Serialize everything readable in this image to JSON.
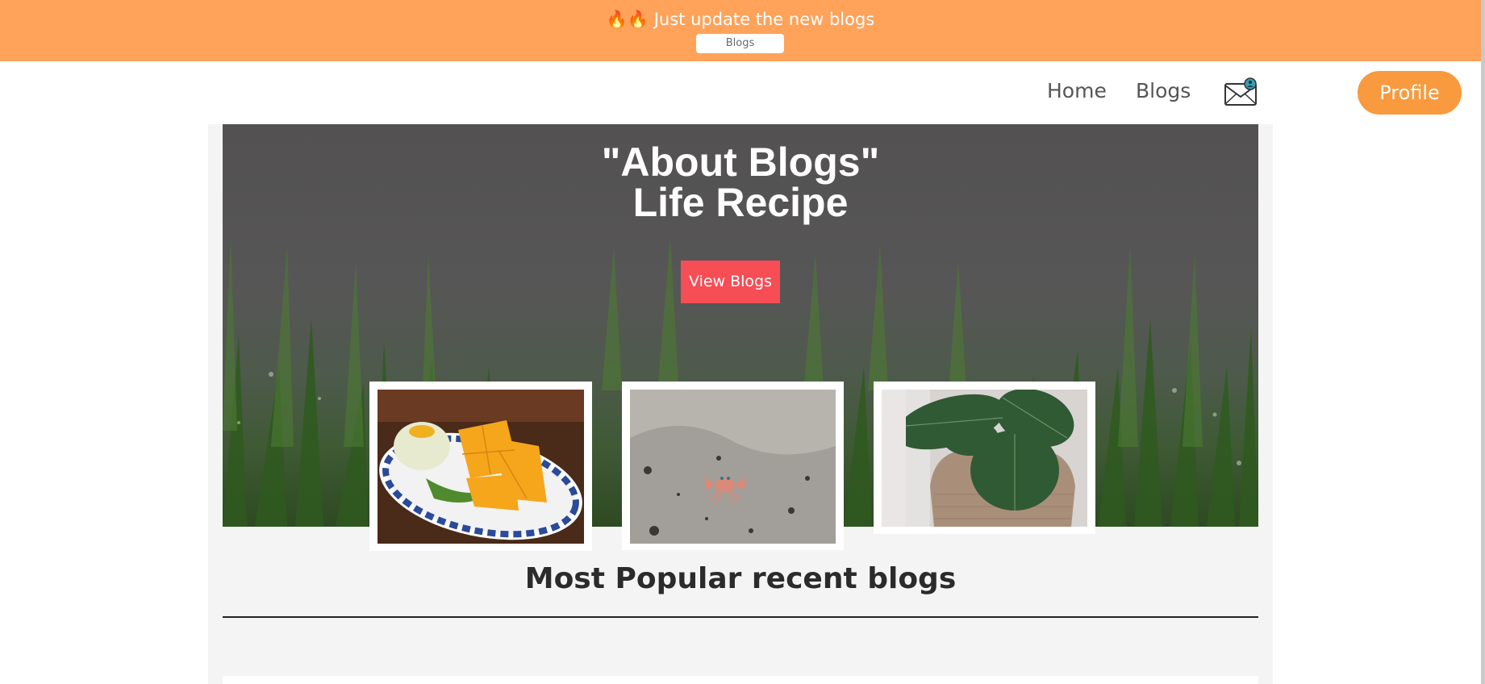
{
  "announcement": {
    "text": "🔥🔥 Just update the new blogs",
    "button_label": "Blogs",
    "background_color": "#ffa25a"
  },
  "nav": {
    "items": [
      {
        "label": "Home"
      },
      {
        "label": "Blogs"
      }
    ],
    "mail_icon": "envelope-user-icon",
    "profile_label": "Profile",
    "profile_color": "#f89a3d"
  },
  "hero": {
    "title_line1": "\"About Blogs\"",
    "title_line2": "Life Recipe",
    "button_label": "View Blogs",
    "button_color": "#f74d55"
  },
  "cards": [
    {
      "image": "mango-sticky-rice-photo"
    },
    {
      "image": "crab-on-sand-photo"
    },
    {
      "image": "potted-plant-photo"
    }
  ],
  "section": {
    "title": "Most Popular recent blogs"
  }
}
